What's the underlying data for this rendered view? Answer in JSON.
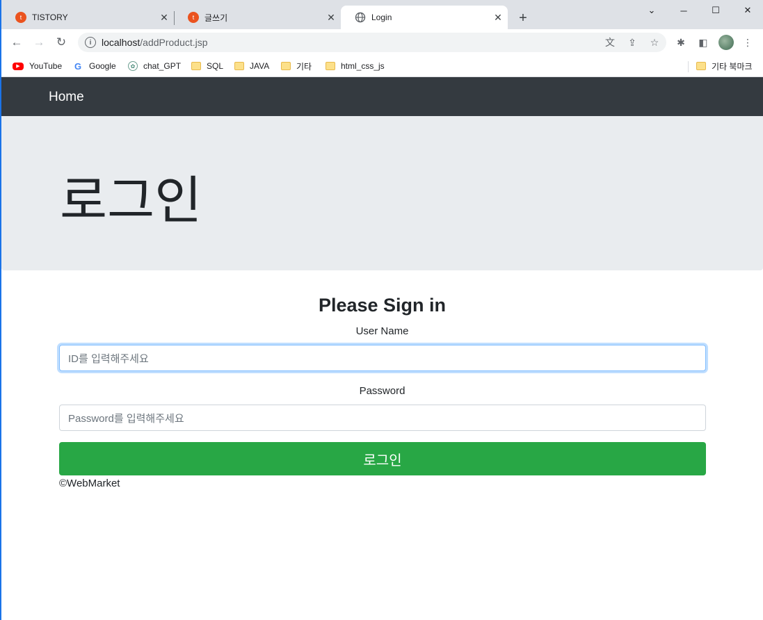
{
  "browser": {
    "tabs": [
      {
        "label": "TISTORY"
      },
      {
        "label": "글쓰기"
      },
      {
        "label": "Login"
      }
    ],
    "url_host": "localhost",
    "url_path": "/addProduct.jsp",
    "bookmarks": [
      {
        "label": "YouTube",
        "icon": "youtube-icon"
      },
      {
        "label": "Google",
        "icon": "google-icon"
      },
      {
        "label": "chat_GPT",
        "icon": "chatgpt-icon"
      },
      {
        "label": "SQL",
        "icon": "folder-icon"
      },
      {
        "label": "JAVA",
        "icon": "folder-icon"
      },
      {
        "label": "기타",
        "icon": "folder-icon"
      },
      {
        "label": "html_css_js",
        "icon": "folder-icon"
      }
    ],
    "other_bookmarks": "기타 북마크"
  },
  "navbar": {
    "home_label": "Home"
  },
  "jumbotron": {
    "title": "로그인"
  },
  "form": {
    "heading": "Please Sign in",
    "username_label": "User Name",
    "username_placeholder": "ID를 입력해주세요",
    "password_label": "Password",
    "password_placeholder": "Password를 입력해주세요",
    "submit_label": "로그인"
  },
  "footer": {
    "text": "©WebMarket"
  },
  "colors": {
    "navbar_bg": "#343a40",
    "jumbotron_bg": "#e9ecef",
    "button_bg": "#28a745",
    "focus_border": "#80bdff"
  }
}
